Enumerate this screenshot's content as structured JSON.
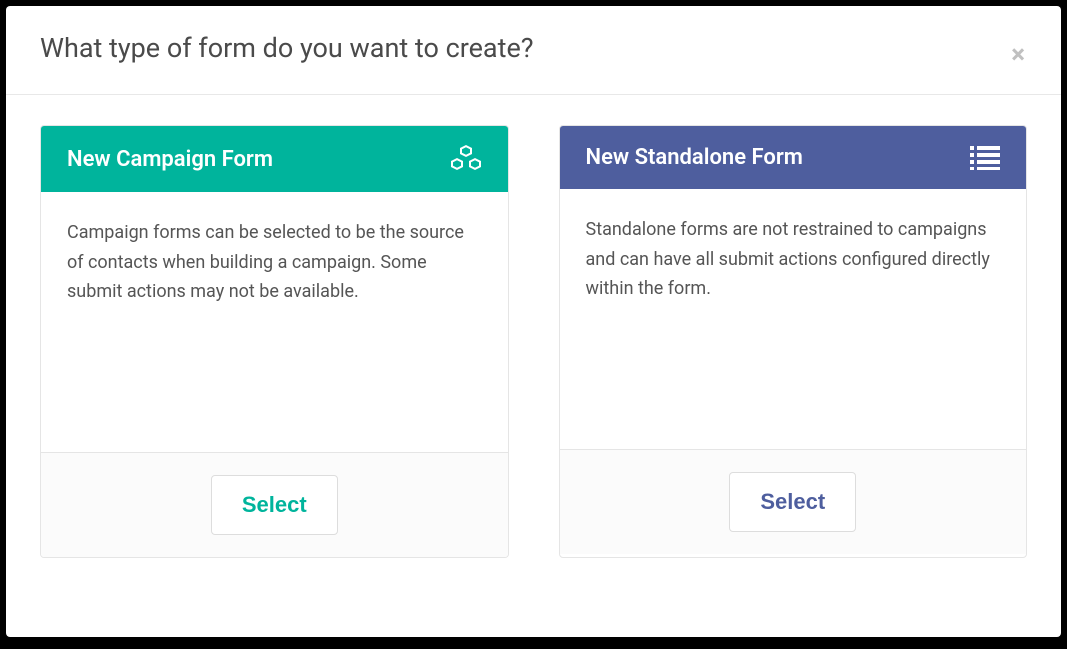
{
  "modal": {
    "title": "What type of form do you want to create?"
  },
  "options": {
    "campaign": {
      "title": "New Campaign Form",
      "description": "Campaign forms can be selected to be the source of contacts when building a campaign. Some submit actions may not be available.",
      "button": "Select"
    },
    "standalone": {
      "title": "New Standalone Form",
      "description": "Standalone forms are not restrained to campaigns and can have all submit actions configured directly within the form.",
      "button": "Select"
    }
  }
}
